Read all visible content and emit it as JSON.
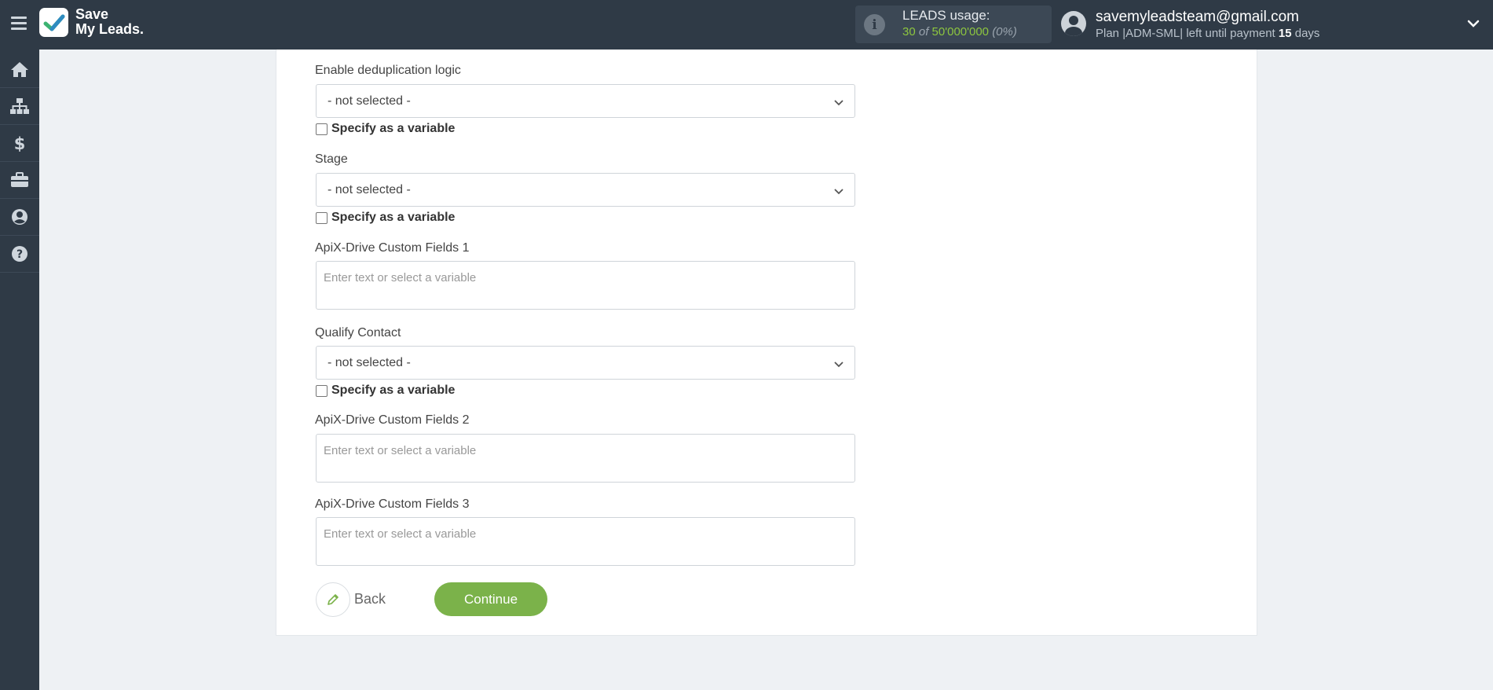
{
  "header": {
    "logo_line1": "Save",
    "logo_line2": "My Leads.",
    "usage_title": "LEADS usage:",
    "usage_used": "30",
    "usage_of": "of",
    "usage_total": "50'000'000",
    "usage_percent": "(0%)",
    "user_email": "savemyleadsteam@gmail.com",
    "plan_prefix": "Plan |ADM-SML| left until payment",
    "plan_days": "15",
    "plan_suffix": "days"
  },
  "sidebar": {
    "items": [
      {
        "icon": "home-icon"
      },
      {
        "icon": "sitemap-icon"
      },
      {
        "icon": "dollar-icon"
      },
      {
        "icon": "briefcase-icon"
      },
      {
        "icon": "user-circle-icon"
      },
      {
        "icon": "question-circle-icon"
      }
    ]
  },
  "form": {
    "dedup": {
      "label": "Enable deduplication logic",
      "value": "- not selected -",
      "checkbox": "Specify as a variable"
    },
    "stage": {
      "label": "Stage",
      "value": "- not selected -",
      "checkbox": "Specify as a variable"
    },
    "custom1": {
      "label": "ApiX-Drive Custom Fields 1",
      "placeholder": "Enter text or select a variable"
    },
    "qualify": {
      "label": "Qualify Contact",
      "value": "- not selected -",
      "checkbox": "Specify as a variable"
    },
    "custom2": {
      "label": "ApiX-Drive Custom Fields 2",
      "placeholder": "Enter text or select a variable"
    },
    "custom3": {
      "label": "ApiX-Drive Custom Fields 3",
      "placeholder": "Enter text or select a variable"
    },
    "back_label": "Back",
    "continue_label": "Continue"
  },
  "colors": {
    "topbar": "#2f3a46",
    "accent_green": "#7bb24a",
    "usage_green": "#8dc63f"
  }
}
